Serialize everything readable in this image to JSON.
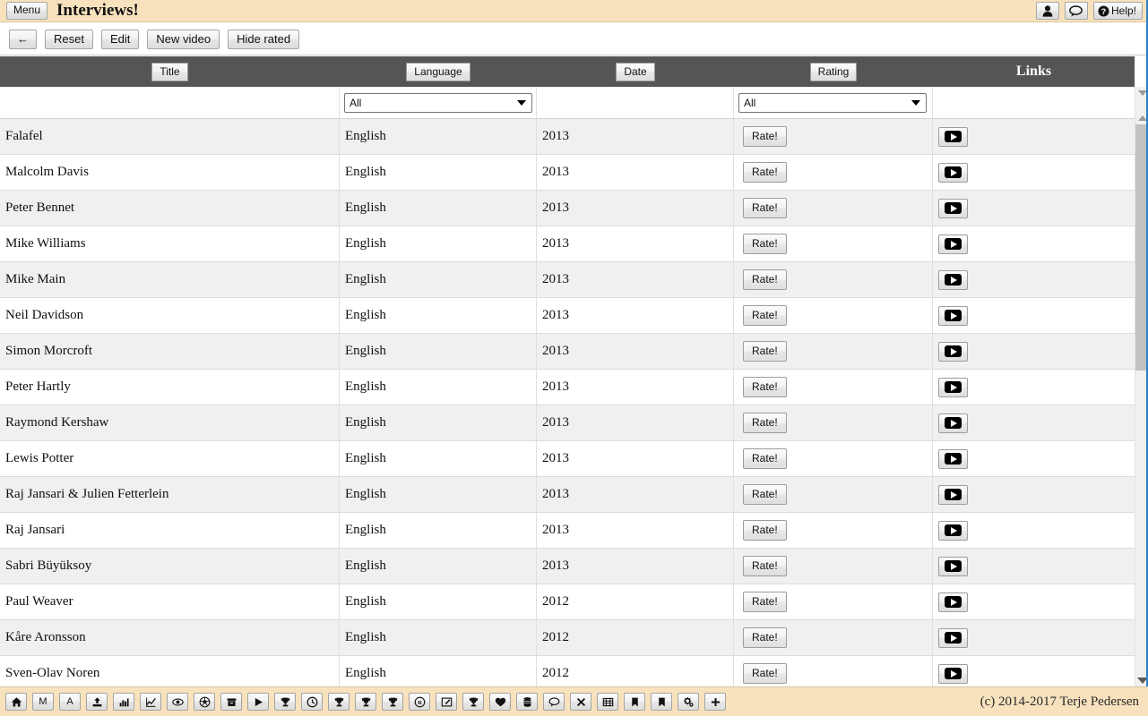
{
  "header": {
    "menu_label": "Menu",
    "title": "Interviews!",
    "user_icon": "person-icon",
    "chat_icon": "speech-bubble-icon",
    "help_label": "Help!",
    "help_icon": "question-circle-icon"
  },
  "toolbar": {
    "back_label": "←",
    "reset_label": "Reset",
    "edit_label": "Edit",
    "new_video_label": "New video",
    "hide_rated_label": "Hide rated"
  },
  "table": {
    "columns": [
      {
        "key": "title",
        "label": "Title",
        "sortable": true
      },
      {
        "key": "language",
        "label": "Language",
        "sortable": true
      },
      {
        "key": "date",
        "label": "Date",
        "sortable": true
      },
      {
        "key": "rating",
        "label": "Rating",
        "sortable": true
      },
      {
        "key": "links",
        "label": "Links",
        "sortable": false
      }
    ],
    "filters": {
      "title": "",
      "language": "All",
      "date": "",
      "rating": "All",
      "language_options": [
        "All"
      ],
      "rating_options": [
        "All"
      ]
    },
    "rate_button_label": "Rate!",
    "link_icon": "youtube-play-icon",
    "rows": [
      {
        "title": "Falafel",
        "language": "English",
        "date": "2013",
        "rating": "Rate!"
      },
      {
        "title": "Malcolm Davis",
        "language": "English",
        "date": "2013",
        "rating": "Rate!"
      },
      {
        "title": "Peter Bennet",
        "language": "English",
        "date": "2013",
        "rating": "Rate!"
      },
      {
        "title": "Mike Williams",
        "language": "English",
        "date": "2013",
        "rating": "Rate!"
      },
      {
        "title": "Mike Main",
        "language": "English",
        "date": "2013",
        "rating": "Rate!"
      },
      {
        "title": "Neil Davidson",
        "language": "English",
        "date": "2013",
        "rating": "Rate!"
      },
      {
        "title": "Simon Morcroft",
        "language": "English",
        "date": "2013",
        "rating": "Rate!"
      },
      {
        "title": "Peter Hartly",
        "language": "English",
        "date": "2013",
        "rating": "Rate!"
      },
      {
        "title": "Raymond Kershaw",
        "language": "English",
        "date": "2013",
        "rating": "Rate!"
      },
      {
        "title": "Lewis Potter",
        "language": "English",
        "date": "2013",
        "rating": "Rate!"
      },
      {
        "title": "Raj Jansari & Julien Fetterlein",
        "language": "English",
        "date": "2013",
        "rating": "Rate!"
      },
      {
        "title": "Raj Jansari",
        "language": "English",
        "date": "2013",
        "rating": "Rate!"
      },
      {
        "title": "Sabri Büyüksoy",
        "language": "English",
        "date": "2013",
        "rating": "Rate!"
      },
      {
        "title": "Paul Weaver",
        "language": "English",
        "date": "2012",
        "rating": "Rate!"
      },
      {
        "title": "Kåre Aronsson",
        "language": "English",
        "date": "2012",
        "rating": "Rate!"
      },
      {
        "title": "Sven-Olav Noren",
        "language": "English",
        "date": "2012",
        "rating": "Rate!"
      }
    ]
  },
  "bottom_toolbar": {
    "icons": [
      {
        "name": "home-icon",
        "glyph": "home"
      },
      {
        "name": "letter-m-icon",
        "glyph": "M"
      },
      {
        "name": "letter-a-icon",
        "glyph": "A"
      },
      {
        "name": "upload-icon",
        "glyph": "upload"
      },
      {
        "name": "bar-chart-icon",
        "glyph": "bar-chart"
      },
      {
        "name": "line-chart-icon",
        "glyph": "line-chart"
      },
      {
        "name": "eye-icon",
        "glyph": "eye"
      },
      {
        "name": "soccer-ball-icon",
        "glyph": "soccer"
      },
      {
        "name": "archive-icon",
        "glyph": "archive"
      },
      {
        "name": "play-icon",
        "glyph": "play"
      },
      {
        "name": "trophy-icon-1",
        "glyph": "trophy"
      },
      {
        "name": "clock-icon",
        "glyph": "clock"
      },
      {
        "name": "trophy-icon-2",
        "glyph": "trophy"
      },
      {
        "name": "trophy-icon-3",
        "glyph": "trophy"
      },
      {
        "name": "trophy-icon-4",
        "glyph": "trophy"
      },
      {
        "name": "registered-icon",
        "glyph": "registered"
      },
      {
        "name": "edit-pencil-icon",
        "glyph": "pencil"
      },
      {
        "name": "trophy-icon-5",
        "glyph": "trophy"
      },
      {
        "name": "heart-icon",
        "glyph": "heart"
      },
      {
        "name": "list-stack-icon",
        "glyph": "list"
      },
      {
        "name": "comment-icon",
        "glyph": "comment"
      },
      {
        "name": "close-x-icon",
        "glyph": "x"
      },
      {
        "name": "film-icon",
        "glyph": "film"
      },
      {
        "name": "bookmark-icon-1",
        "glyph": "bookmark"
      },
      {
        "name": "bookmark-icon-2",
        "glyph": "bookmark"
      },
      {
        "name": "gears-icon",
        "glyph": "gears"
      },
      {
        "name": "plus-icon",
        "glyph": "plus"
      }
    ],
    "copyright": "(c) 2014-2017 Terje Pedersen"
  },
  "colors": {
    "header_bg": "#f7e2bd",
    "table_head_bg": "#555555",
    "row_odd": "#f0f0f0",
    "row_even": "#ffffff",
    "accent_edge": "#2b7fc9"
  }
}
